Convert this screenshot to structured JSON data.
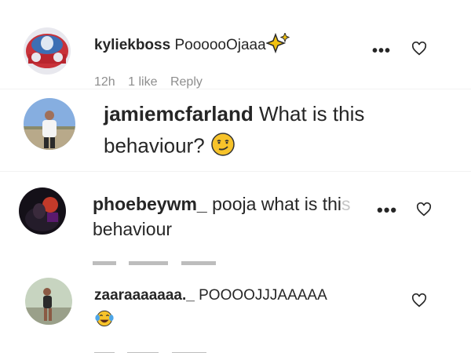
{
  "comments": [
    {
      "username": "kyliekboss",
      "text": "PoooooOjaaa",
      "emoji": "sparkles-icon",
      "meta": {
        "time": "12h",
        "likes": "1 like",
        "reply": "Reply"
      }
    },
    {
      "username": "jamiemcfarland",
      "text_line1": "What is this",
      "text_line2": "behaviour?",
      "emoji": "smirk-face-icon"
    },
    {
      "username": "phoebeywm_",
      "text_line1": "pooja what is thi",
      "text_fade": "s",
      "text_line2": "behaviour"
    },
    {
      "username": "zaaraaaaaaa._",
      "text": "POOOOJJJAAAAA",
      "emoji": "tears-of-joy-icon"
    }
  ],
  "colors": {
    "text": "#262626",
    "secondary": "#8e8e8e",
    "emoji_yellow": "#f7c32a"
  }
}
